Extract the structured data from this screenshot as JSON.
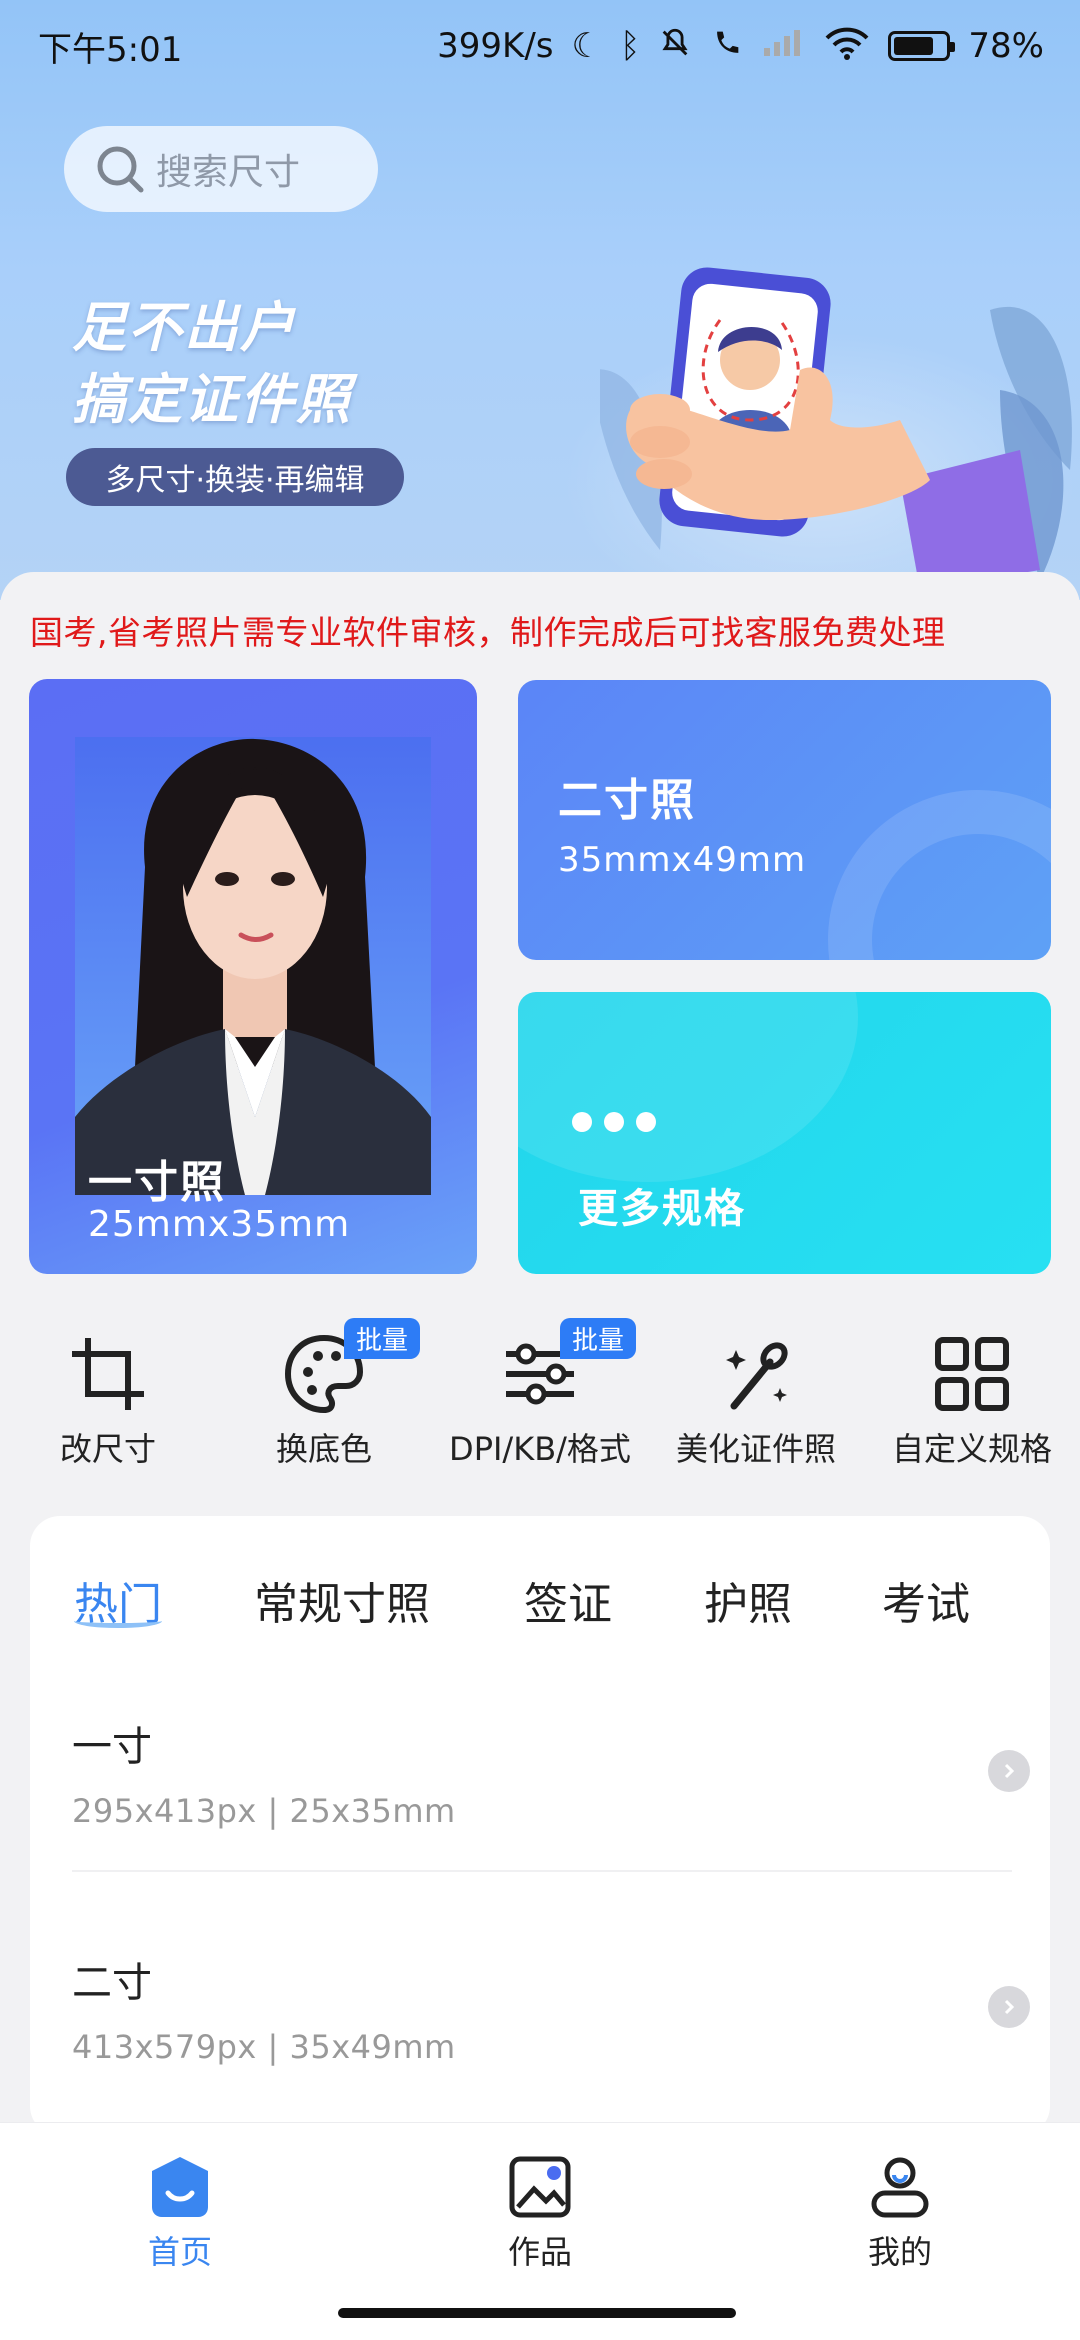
{
  "status_bar": {
    "time": "下午5:01",
    "net_speed": "399K/s",
    "battery": "78%",
    "icons": [
      "moon-icon",
      "bluetooth-icon",
      "mute-icon",
      "call-icon",
      "signal-icon",
      "wifi-icon",
      "battery-icon"
    ]
  },
  "search": {
    "placeholder": "搜索尺寸"
  },
  "banner": {
    "line1": "足不出户",
    "line2": "搞定证件照",
    "pill": "多尺寸·换装·再编辑"
  },
  "notice": "国考,省考照片需专业软件审核，制作完成后可找客服免费处理",
  "cards": {
    "one_inch": {
      "title": "一寸照",
      "size": "25mmx35mm"
    },
    "two_inch": {
      "title": "二寸照",
      "size": "35mmx49mm"
    },
    "more": {
      "title": "更多规格"
    }
  },
  "tools": [
    {
      "label": "改尺寸",
      "icon": "crop-icon",
      "badge": ""
    },
    {
      "label": "换底色",
      "icon": "palette-icon",
      "badge": "批量"
    },
    {
      "label": "DPI/KB/格式",
      "icon": "sliders-icon",
      "badge": "批量"
    },
    {
      "label": "美化证件照",
      "icon": "magic-wand-icon",
      "badge": ""
    },
    {
      "label": "自定义规格",
      "icon": "grid-icon",
      "badge": ""
    }
  ],
  "tabs": [
    "热门",
    "常规寸照",
    "签证",
    "护照",
    "考试"
  ],
  "active_tab": "热门",
  "list": [
    {
      "name": "一寸",
      "spec": "295x413px  |  25x35mm"
    },
    {
      "name": "二寸",
      "spec": "413x579px  |  35x49mm"
    }
  ],
  "nav": [
    {
      "label": "首页",
      "icon": "home-icon",
      "active": true
    },
    {
      "label": "作品",
      "icon": "gallery-icon",
      "active": false
    },
    {
      "label": "我的",
      "icon": "profile-icon",
      "active": false
    }
  ],
  "colors": {
    "accent": "#3a86f0",
    "notice": "#e0191a",
    "card_one": "#5b6ef4",
    "card_two": "#5b8ff7",
    "card_three": "#25dbf0"
  }
}
